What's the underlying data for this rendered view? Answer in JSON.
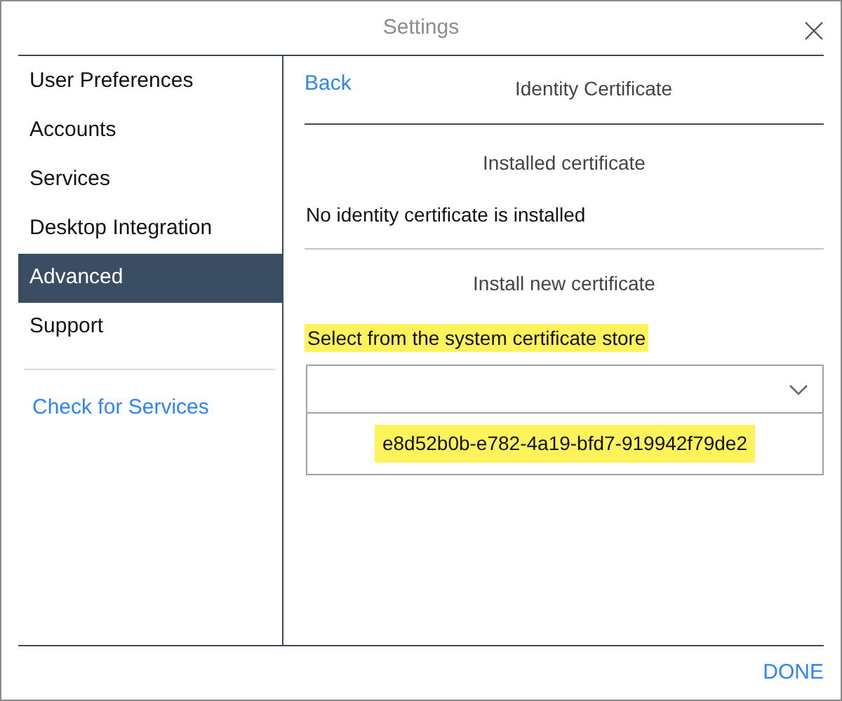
{
  "window": {
    "title": "Settings"
  },
  "sidebar": {
    "items": [
      {
        "label": "User Preferences",
        "selected": false
      },
      {
        "label": "Accounts",
        "selected": false
      },
      {
        "label": "Services",
        "selected": false
      },
      {
        "label": "Desktop Integration",
        "selected": false
      },
      {
        "label": "Advanced",
        "selected": true
      },
      {
        "label": "Support",
        "selected": false
      }
    ],
    "link": "Check for Services"
  },
  "panel": {
    "back": "Back",
    "title": "Identity Certificate",
    "installed_heading": "Installed certificate",
    "installed_status": "No identity certificate is installed",
    "install_heading": "Install new certificate",
    "select_label": {
      "text": "Select from the system certificate store",
      "highlighted": true
    },
    "options": [
      {
        "text": "e8d52b0b-e782-4a19-bfd7-919942f79de2",
        "highlighted": true
      }
    ]
  },
  "footer": {
    "done": "DONE"
  }
}
